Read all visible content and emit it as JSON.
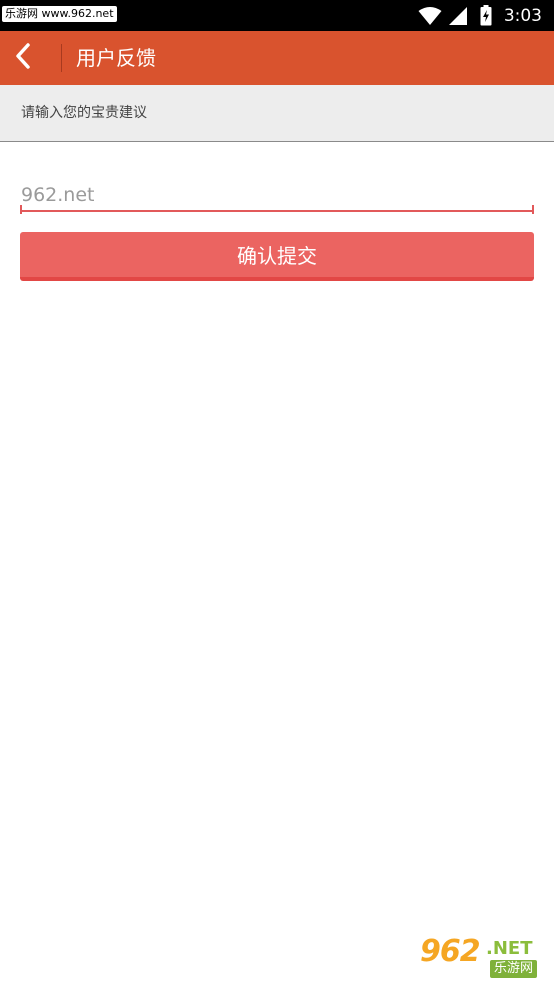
{
  "status_bar": {
    "watermark_text": "乐游网 www.962.net",
    "time": "3:03",
    "icons": [
      "wifi-icon",
      "signal-icon",
      "battery-charging-icon"
    ]
  },
  "app_bar": {
    "back_icon": "chevron-left-icon",
    "title": "用户反馈",
    "background_color": "#d9532e"
  },
  "hint": {
    "text": "请输入您的宝贵建议"
  },
  "form": {
    "input_value": "",
    "input_placeholder": "962.net",
    "submit_label": "确认提交",
    "accent_color": "#e2595a",
    "button_color": "#eb6461"
  },
  "watermark": {
    "number": "962",
    "suffix": ".NET",
    "chinese": "乐游网"
  }
}
